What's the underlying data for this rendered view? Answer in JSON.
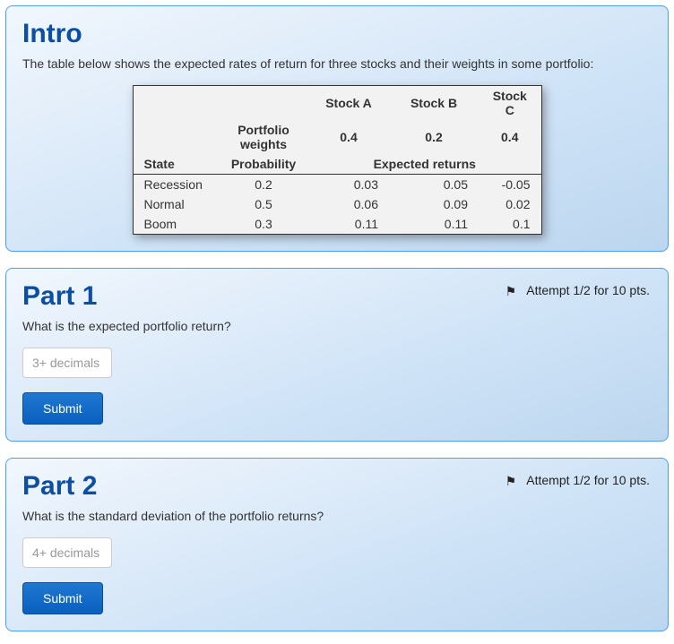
{
  "intro": {
    "title": "Intro",
    "description": "The table below shows the expected rates of return for three stocks and their weights in some portfolio:",
    "table": {
      "stock_labels": {
        "a": "Stock A",
        "b": "Stock B",
        "c": "Stock C"
      },
      "weights_label": "Portfolio weights",
      "weights": {
        "a": "0.4",
        "b": "0.2",
        "c": "0.4"
      },
      "state_header": "State",
      "probability_header": "Probability",
      "expected_returns_header": "Expected returns",
      "rows": [
        {
          "state": "Recession",
          "prob": "0.2",
          "a": "0.03",
          "b": "0.05",
          "c": "-0.05"
        },
        {
          "state": "Normal",
          "prob": "0.5",
          "a": "0.06",
          "b": "0.09",
          "c": "0.02"
        },
        {
          "state": "Boom",
          "prob": "0.3",
          "a": "0.11",
          "b": "0.11",
          "c": "0.1"
        }
      ]
    }
  },
  "part1": {
    "title": "Part 1",
    "attempt": "Attempt 1/2 for 10 pts.",
    "question": "What is the expected portfolio return?",
    "placeholder": "3+ decimals",
    "submit": "Submit"
  },
  "part2": {
    "title": "Part 2",
    "attempt": "Attempt 1/2 for 10 pts.",
    "question": "What is the standard deviation of the portfolio returns?",
    "placeholder": "4+ decimals",
    "submit": "Submit"
  }
}
